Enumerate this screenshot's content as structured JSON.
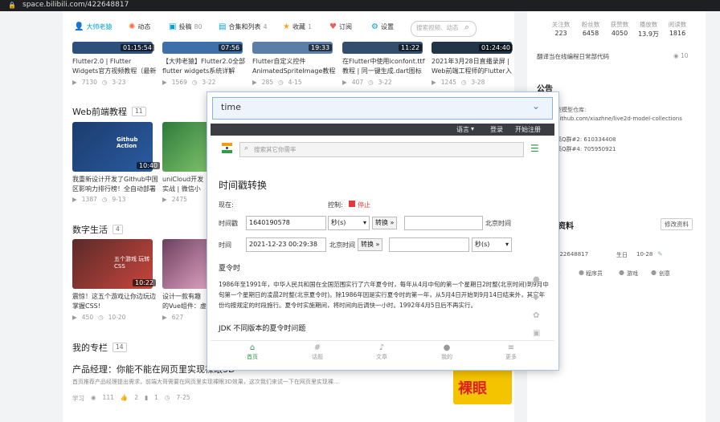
{
  "browser": {
    "url": "space.bilibili.com/422648817"
  },
  "nav": {
    "items": [
      {
        "label": "大帅老猿",
        "count": "",
        "icon": "avatar-icon"
      },
      {
        "label": "动态",
        "count": "",
        "icon": "dynamic-icon"
      },
      {
        "label": "投稿",
        "count": "80",
        "icon": "upload-icon"
      },
      {
        "label": "合集和列表",
        "count": "4",
        "icon": "collection-icon"
      },
      {
        "label": "收藏",
        "count": "1",
        "icon": "star-icon"
      },
      {
        "label": "订阅",
        "count": "",
        "icon": "heart-icon"
      },
      {
        "label": "设置",
        "count": "",
        "icon": "gear-icon"
      }
    ],
    "search_placeholder": "搜索视频、动态",
    "stats": [
      {
        "label": "关注数",
        "value": "223"
      },
      {
        "label": "粉丝数",
        "value": "6458"
      },
      {
        "label": "获赞数",
        "value": "4050"
      },
      {
        "label": "播放数",
        "value": "13.9万"
      },
      {
        "label": "阅读数",
        "value": "1816"
      }
    ]
  },
  "video_row1": [
    {
      "duration": "01:15:54",
      "title": "Flutter2.0 | Flutter Widgets官方视频教程（最新",
      "plays": "7130",
      "date": "3-23"
    },
    {
      "duration": "07:56",
      "title": "【大帅老猿】Flutter2.0全部 flutter widgets系统详解",
      "plays": "1569",
      "date": "3-22"
    },
    {
      "duration": "19:33",
      "title": "Flutter自定义控件 AnimatedSpriteImage教程",
      "plays": "285",
      "date": "4-15"
    },
    {
      "duration": "11:22",
      "title": "在Flutter中使用iconfont.ttf 教程 | 同一键生成.dart图标",
      "plays": "407",
      "date": "3-22"
    },
    {
      "duration": "01:24:40",
      "title": "2021年3月28日直播录屏 | Web前端工程师的Flutter入",
      "plays": "1245",
      "date": "3-28"
    }
  ],
  "sections": {
    "web": {
      "title": "Web前端教程",
      "count": "11"
    },
    "digital": {
      "title": "数字生活",
      "count": "4"
    },
    "column": {
      "title": "我的专栏",
      "count": "14"
    }
  },
  "video_row2": [
    {
      "duration": "10:40",
      "title": "我重新设计开发了Github中国区影响力排行榜！全自动部署",
      "plays": "1387",
      "date": "9-13",
      "thumb_text": "Github Action"
    },
    {
      "duration": "",
      "title": "uniCloud开发实战 | 微信小程序的分类页面",
      "plays": "2475",
      "date": ""
    }
  ],
  "video_row3": [
    {
      "duration": "10:22",
      "title": "震惊！这五个游戏让你边玩边掌握CSS!",
      "plays": "450",
      "date": "10-20",
      "thumb_text": "五个游戏 玩转CSS"
    },
    {
      "duration": "",
      "title": "设计一款有趣的Vue组件：虚拟桌宠",
      "plays": "627",
      "date": ""
    }
  ],
  "article": {
    "title": "产品经理：你能不能在网页里实现裸眼3D",
    "summary": "首页推荐产品经理提出需求，前端大哥需要在网页里实现裸眼3D效果，这次我们来试一下在网页里实现裸...",
    "tag": "学习",
    "views": "111",
    "likes": "2",
    "comments": "1",
    "date": "7-25",
    "thumb_text": "裸眼"
  },
  "right_panel": {
    "top_link": "翻译当在线编程日常部代码",
    "top_count": "10",
    "announce_title": "公告",
    "announce_lines": [
      "型模型仓库:",
      "github.com/xiazhne/live2d-model-collections",
      "",
      "高Q群#2: 610334408",
      "高Q群#4: 705950921"
    ],
    "profile_title": "资料",
    "edit_label": "修改资料",
    "uid": "422648817",
    "birthday_label": "生日",
    "birthday": "10-28",
    "tags": [
      "程序员",
      "游戏",
      "创意"
    ]
  },
  "popup": {
    "search_value": "time",
    "dark_links": [
      "语言",
      "登录",
      "开始注册"
    ],
    "site_search_placeholder": "搜索其它你需率",
    "heading": "时间戳转换",
    "now_label": "现在:",
    "control_label": "控制:",
    "stop_label": "停止",
    "ts_label": "时间戳",
    "ts_value": "1640190578",
    "unit1": "秒(s)",
    "convert1": "转换 »",
    "beijing1": "北京时间",
    "time_label": "时间",
    "time_value": "2021-12-23 00:29:38",
    "beijing2": "北京时间",
    "convert2": "转换 »",
    "unit2": "秒(s)",
    "dst_title": "夏令时",
    "dst_para": "1986年至1991年，中华人民共和国在全国范围实行了六年夏令时，每年从4月中旬的第一个星期日2时整(北京时间)到9月中旬第一个星期日的凌晨2时整(北京夏令时)。除1986年因是实行夏令时的第一年，从5月4日开始到9月14日结束外，其它年份均按规定的时段施行。夏令时实施期间，将时间向后调快一小时。1992年4月5日后不再实行。",
    "jdk_title": "JDK 不同版本的夏令时问题",
    "bottom_nav": [
      {
        "label": "首页",
        "icon": "home-icon"
      },
      {
        "label": "话题",
        "icon": "hash-icon"
      },
      {
        "label": "文章",
        "icon": "article-icon"
      },
      {
        "label": "我的",
        "icon": "user-icon"
      },
      {
        "label": "更多",
        "icon": "more-icon"
      }
    ]
  }
}
